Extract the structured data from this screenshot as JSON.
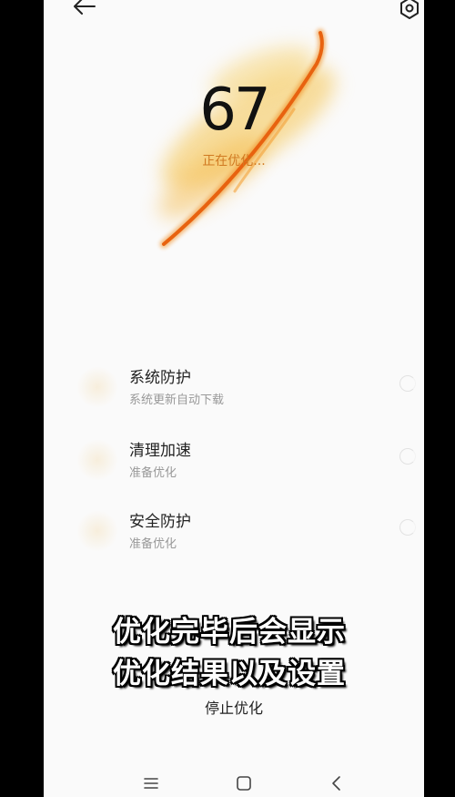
{
  "header": {
    "back_icon": "arrow-left-icon",
    "settings_icon": "gear-hexagon-icon"
  },
  "progress": {
    "score": "67",
    "status": "正在优化..."
  },
  "tasks": [
    {
      "title": "系统防护",
      "subtitle": "系统更新自动下载"
    },
    {
      "title": "清理加速",
      "subtitle": "准备优化"
    },
    {
      "title": "安全防护",
      "subtitle": "准备优化"
    }
  ],
  "overlay_caption": {
    "line1": "优化完毕后会显示",
    "line2": "优化结果以及设置"
  },
  "actions": {
    "stop_label": "停止优化"
  },
  "navbar": {
    "menu_icon": "menu-icon",
    "home_icon": "home-square-icon",
    "back_icon": "chevron-left-icon"
  },
  "colors": {
    "accent": "#e8620f",
    "glow": "#f5c450",
    "status_text": "#d07a22"
  }
}
